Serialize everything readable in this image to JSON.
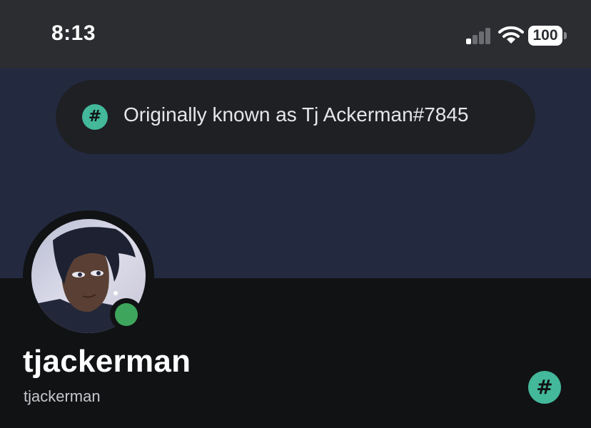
{
  "status_bar": {
    "time": "8:13",
    "battery": "100",
    "signal_icon": "cellular-signal-icon",
    "wifi_icon": "wifi-icon",
    "battery_icon": "battery-icon"
  },
  "notice": {
    "icon": "hashtag-badge-icon",
    "text": "Originally known as Tj Ackerman#7845"
  },
  "profile": {
    "display_name": "tjackerman",
    "username": "tjackerman",
    "presence": "online",
    "badge_icon": "hashtag-badge-icon"
  },
  "colors": {
    "status_bar_bg": "#2b2d31",
    "banner_bg": "#232a40",
    "page_bg": "#111214",
    "notice_pill_bg": "#1f2024",
    "accent_teal": "#43b89a",
    "online_green": "#3ea55c"
  }
}
